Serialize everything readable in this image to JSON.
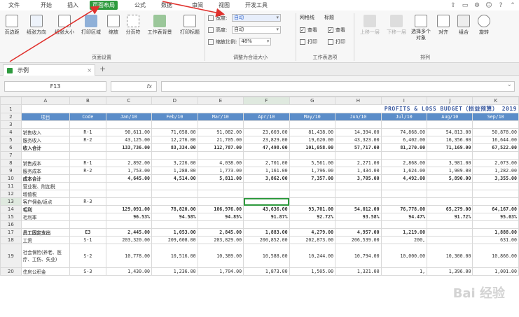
{
  "menu": {
    "tabs": [
      "文件",
      "开始",
      "插入",
      "页面布局",
      "公式",
      "数据",
      "审阅",
      "视图",
      "开发工具"
    ],
    "active_index": 3
  },
  "ribbon": {
    "page_setup": {
      "buttons": [
        "页边距",
        "纸张方向",
        "纸张大小",
        "打印区域",
        "缩放",
        "分页符",
        "工作表背景",
        "打印标题"
      ],
      "label": "页面设置"
    },
    "scale_to_fit": {
      "width_label": "宽度:",
      "width_value": "自动",
      "height_label": "高度:",
      "height_value": "自动",
      "scale_label": "缩放比例:",
      "scale_value": "48%",
      "label": "调整为合适大小"
    },
    "sheet_options": {
      "gridlines_label": "网格线",
      "headings_label": "标题",
      "view_label": "查看",
      "print_label": "打印",
      "gridlines_view_checked": true,
      "headings_view_checked": true,
      "label": "工作表选项"
    },
    "arrange": {
      "buttons": [
        "上移一层",
        "下移一层",
        "选择多个对象",
        "对齐",
        "组合",
        "旋转"
      ],
      "label": "排列"
    }
  },
  "doc_tab": {
    "title": "示例"
  },
  "formula_bar": {
    "name_box": "F13",
    "fx": "fx",
    "content": ""
  },
  "sheet": {
    "title": "PROFITS & LOSS BUDGET（损益预算） 2019",
    "col_letters": [
      "A",
      "B",
      "C",
      "D",
      "E",
      "F",
      "G",
      "H",
      "I",
      "J",
      "K"
    ],
    "header": [
      "项目",
      "Code",
      "Jan/10",
      "Feb/10",
      "Mar/10",
      "Apr/10",
      "May/10",
      "Jun/10",
      "Jul/10",
      "Aug/10",
      "Sep/10"
    ],
    "rows": [
      {
        "n": "3",
        "cells": [
          "",
          "",
          "",
          "",
          "",
          "",
          "",
          "",
          "",
          "",
          ""
        ]
      },
      {
        "n": "4",
        "cells": [
          "销售收入",
          "R-1",
          "90,611.00",
          "71,058.00",
          "91,082.00",
          "23,669.00",
          "81,438.00",
          "14,394.00",
          "74,868.00",
          "54,813.00",
          "50,878.00"
        ]
      },
      {
        "n": "5",
        "cells": [
          "服务收入",
          "R-2",
          "43,125.00",
          "12,276.00",
          "21,705.00",
          "23,829.00",
          "19,620.00",
          "43,323.00",
          "6,402.00",
          "16,356.00",
          "16,644.00"
        ]
      },
      {
        "n": "6",
        "cells": [
          "收入合计",
          "",
          "133,736.00",
          "83,334.00",
          "112,787.00",
          "47,498.00",
          "101,058.00",
          "57,717.00",
          "81,270.00",
          "71,169.00",
          "67,522.00"
        ],
        "bold": true
      },
      {
        "n": "7",
        "cells": [
          "",
          "",
          "",
          "",
          "",
          "",
          "",
          "",
          "",
          "",
          ""
        ]
      },
      {
        "n": "8",
        "cells": [
          "销售成本",
          "R-1",
          "2,892.00",
          "3,226.00",
          "4,038.00",
          "2,701.00",
          "5,561.00",
          "2,271.00",
          "2,868.00",
          "3,981.00",
          "2,073.00"
        ]
      },
      {
        "n": "9",
        "cells": [
          "服务成本",
          "R-2",
          "1,753.00",
          "1,288.00",
          "1,773.00",
          "1,161.00",
          "1,796.00",
          "1,434.00",
          "1,624.00",
          "1,909.00",
          "1,282.00"
        ]
      },
      {
        "n": "10",
        "cells": [
          "成本合计",
          "",
          "4,645.00",
          "4,514.00",
          "5,811.00",
          "3,862.00",
          "7,357.00",
          "3,705.00",
          "4,492.00",
          "5,890.00",
          "3,355.00"
        ],
        "bold": true
      },
      {
        "n": "11",
        "cells": [
          "营业税、附加税",
          "",
          "",
          "",
          "",
          "",
          "",
          "",
          "",
          "",
          ""
        ]
      },
      {
        "n": "12",
        "cells": [
          "增值税",
          "",
          "",
          "",
          "",
          "",
          "",
          "",
          "",
          "",
          ""
        ]
      },
      {
        "n": "13",
        "cells": [
          "客户佣金/返点",
          "R-3",
          "",
          "",
          "",
          "",
          "",
          "",
          "",
          "",
          ""
        ]
      },
      {
        "n": "14",
        "cells": [
          "毛利",
          "",
          "129,091.00",
          "78,820.00",
          "106,976.00",
          "43,636.00",
          "93,701.00",
          "54,012.00",
          "76,778.00",
          "65,279.00",
          "64,167.00"
        ],
        "bold": true
      },
      {
        "n": "15",
        "cells": [
          "毛利率",
          "",
          "96.53%",
          "94.58%",
          "94.85%",
          "91.87%",
          "92.72%",
          "93.58%",
          "94.47%",
          "91.72%",
          "95.03%"
        ],
        "bold_nums": true
      },
      {
        "n": "16",
        "cells": [
          "",
          "",
          "",
          "",
          "",
          "",
          "",
          "",
          "",
          "",
          ""
        ]
      },
      {
        "n": "17",
        "cells": [
          "员工固定支出",
          "E3",
          "2,445.00",
          "1,053.00",
          "2,845.00",
          "1,883.00",
          "4,279.00",
          "4,957.00",
          "1,219.00",
          "",
          "1,888.00"
        ],
        "bold": true
      },
      {
        "n": "18",
        "cells": [
          "工资",
          "S-1",
          "203,320.00",
          "209,608.00",
          "203,829.00",
          "200,852.00",
          "202,873.00",
          "206,539.00",
          "200,",
          "",
          "631.00"
        ]
      },
      {
        "n": "19",
        "cells": [
          "社会保险(养老、医疗、工伤、失业)",
          "S-2",
          "10,778.00",
          "10,516.00",
          "10,389.00",
          "10,588.00",
          "10,244.00",
          "10,794.00",
          "10,000.00",
          "10,300.00",
          "10,866.00"
        ],
        "tall": true
      },
      {
        "n": "20",
        "cells": [
          "住房公积金",
          "S-3",
          "1,430.00",
          "1,236.00",
          "1,704.00",
          "1,873.00",
          "1,505.00",
          "1,321.00",
          "1,",
          "1,396.00",
          "1,001.00"
        ]
      }
    ],
    "selected_cell": {
      "row": "13",
      "col": "F"
    }
  },
  "watermark": "Bai 经验",
  "colors": {
    "accent_green": "#2e9a3e",
    "header_blue": "#5b8dc9",
    "title_blue": "#3b5aa0",
    "arrow_red": "#e0312d"
  }
}
